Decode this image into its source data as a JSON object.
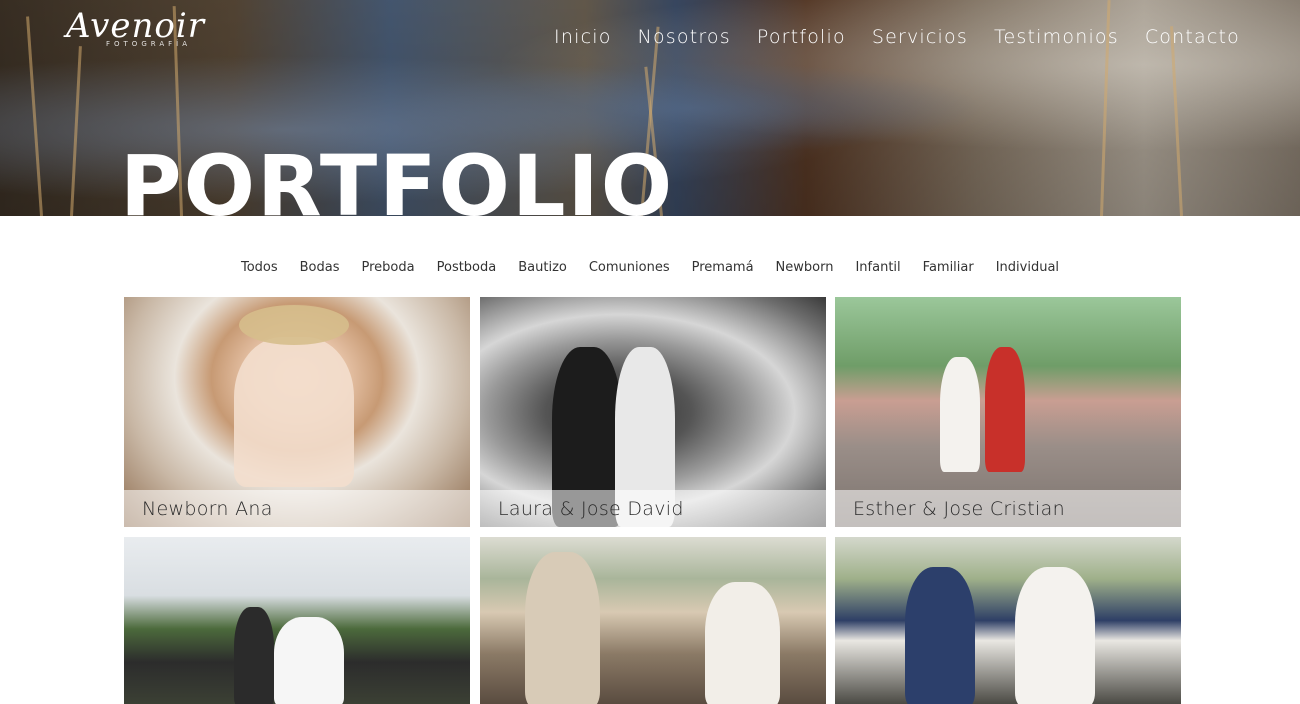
{
  "brand": {
    "name": "Avenoir",
    "tagline": "FOTOGRAFÍA"
  },
  "nav": {
    "items": [
      "Inicio",
      "Nosotros",
      "Portfolio",
      "Servicios",
      "Testimonios",
      "Contacto"
    ]
  },
  "hero": {
    "title": "PORTFOLIO"
  },
  "filters": [
    "Todos",
    "Bodas",
    "Preboda",
    "Postboda",
    "Bautizo",
    "Comuniones",
    "Premamá",
    "Newborn",
    "Infantil",
    "Familiar",
    "Individual"
  ],
  "gallery": [
    {
      "caption": "Newborn Ana"
    },
    {
      "caption": "Laura & Jose David"
    },
    {
      "caption": "Esther & Jose Cristian"
    },
    {
      "caption": ""
    },
    {
      "caption": ""
    },
    {
      "caption": ""
    }
  ]
}
